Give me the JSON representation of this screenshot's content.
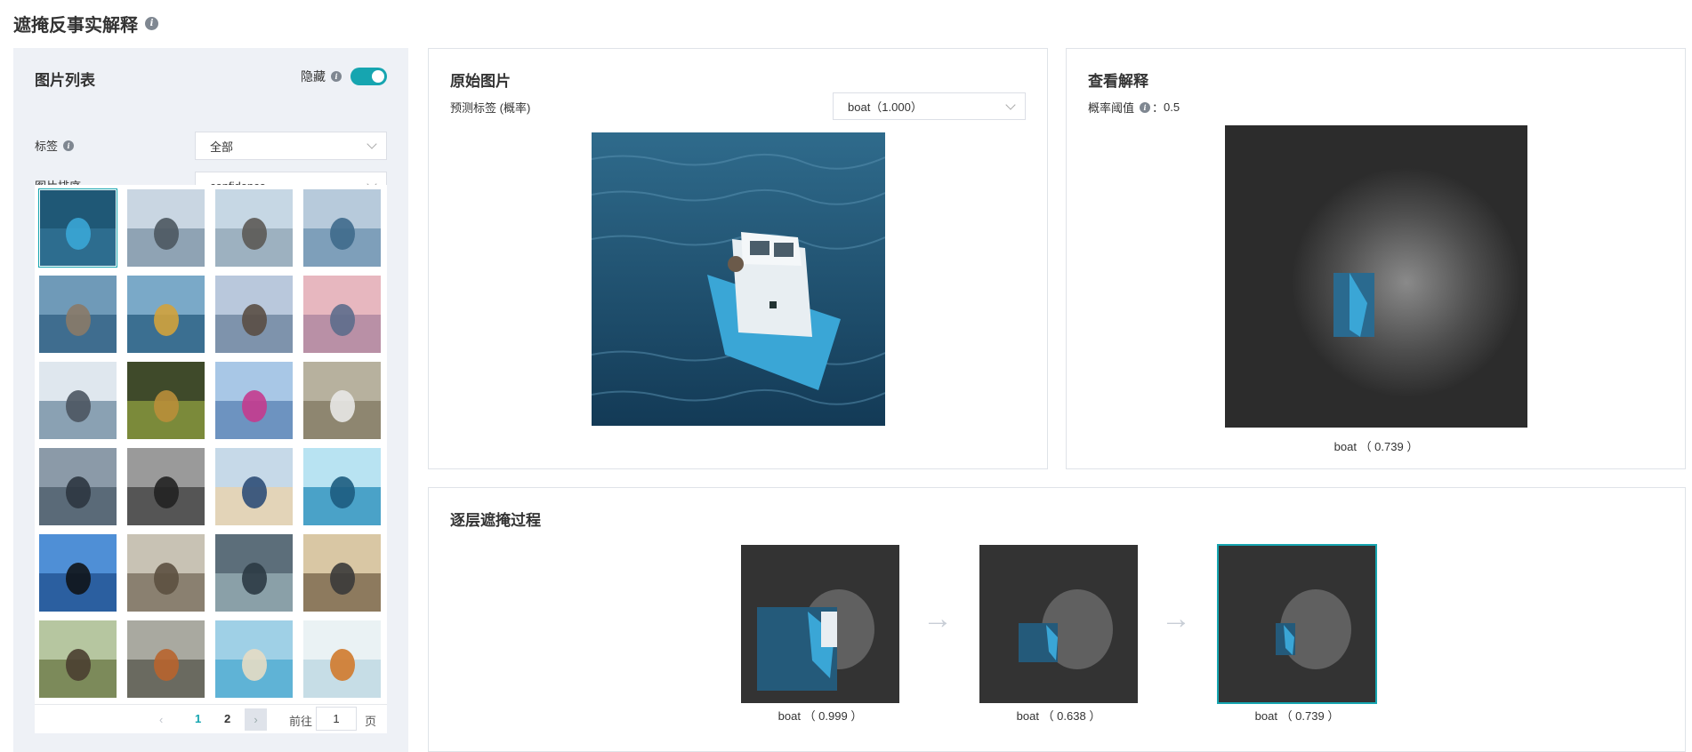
{
  "page": {
    "title": "遮掩反事实解释"
  },
  "left": {
    "title": "图片列表",
    "hide_label": "隐藏",
    "hide_on": true,
    "tag_label": "标签",
    "tag_value": "全部",
    "sort_label": "图片排序",
    "sort_value": "confidence",
    "thumbnails": [
      "boat",
      "rocks-shore",
      "people-shore",
      "sea-sailboat",
      "pelican",
      "sail",
      "branches",
      "sunset-sea",
      "snowy-lake",
      "leaves",
      "hummingbird",
      "gull-rocks",
      "paddle-board",
      "street-people",
      "beach-person",
      "surfer",
      "silhouette-bird",
      "bird-grass",
      "window",
      "canal-city",
      "sparrows",
      "bird-bark",
      "beach-girl",
      "kingfisher"
    ],
    "pager": {
      "prev": "‹",
      "page1": "1",
      "page2": "2",
      "next": "›",
      "goto": "前往",
      "input": "1",
      "unit": "页"
    }
  },
  "original": {
    "title": "原始图片",
    "pred_label": "预测标签 (概率)",
    "pred_value": "boat（1.000）"
  },
  "explain": {
    "title": "查看解释",
    "threshold_label": "概率阈值",
    "threshold_sep": "：",
    "threshold_value": "0.5",
    "caption": "boat （ 0.739 ）"
  },
  "process": {
    "title": "逐层遮掩过程",
    "steps": [
      {
        "caption": "boat （ 0.999 ）"
      },
      {
        "caption": "boat （ 0.638 ）"
      },
      {
        "caption": "boat （ 0.739 ）"
      }
    ],
    "arrow": "→"
  },
  "colors": {
    "accent": "#16a5b0",
    "panel_bg": "#eef1f6"
  }
}
